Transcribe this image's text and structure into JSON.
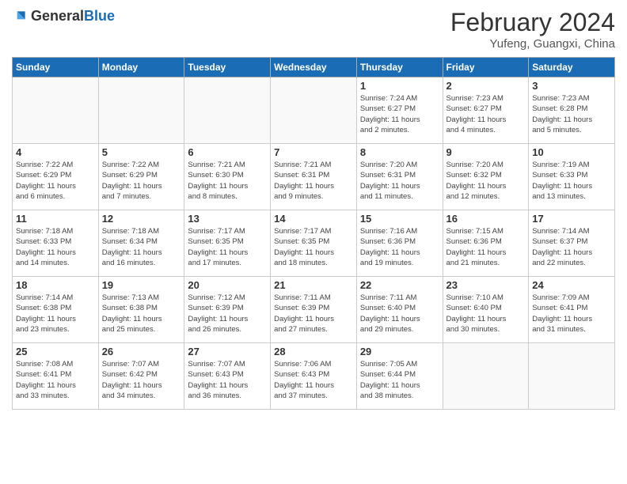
{
  "header": {
    "logo_general": "General",
    "logo_blue": "Blue",
    "month_year": "February 2024",
    "location": "Yufeng, Guangxi, China"
  },
  "weekdays": [
    "Sunday",
    "Monday",
    "Tuesday",
    "Wednesday",
    "Thursday",
    "Friday",
    "Saturday"
  ],
  "weeks": [
    [
      {
        "day": "",
        "info": ""
      },
      {
        "day": "",
        "info": ""
      },
      {
        "day": "",
        "info": ""
      },
      {
        "day": "",
        "info": ""
      },
      {
        "day": "1",
        "info": "Sunrise: 7:24 AM\nSunset: 6:27 PM\nDaylight: 11 hours\nand 2 minutes."
      },
      {
        "day": "2",
        "info": "Sunrise: 7:23 AM\nSunset: 6:27 PM\nDaylight: 11 hours\nand 4 minutes."
      },
      {
        "day": "3",
        "info": "Sunrise: 7:23 AM\nSunset: 6:28 PM\nDaylight: 11 hours\nand 5 minutes."
      }
    ],
    [
      {
        "day": "4",
        "info": "Sunrise: 7:22 AM\nSunset: 6:29 PM\nDaylight: 11 hours\nand 6 minutes."
      },
      {
        "day": "5",
        "info": "Sunrise: 7:22 AM\nSunset: 6:29 PM\nDaylight: 11 hours\nand 7 minutes."
      },
      {
        "day": "6",
        "info": "Sunrise: 7:21 AM\nSunset: 6:30 PM\nDaylight: 11 hours\nand 8 minutes."
      },
      {
        "day": "7",
        "info": "Sunrise: 7:21 AM\nSunset: 6:31 PM\nDaylight: 11 hours\nand 9 minutes."
      },
      {
        "day": "8",
        "info": "Sunrise: 7:20 AM\nSunset: 6:31 PM\nDaylight: 11 hours\nand 11 minutes."
      },
      {
        "day": "9",
        "info": "Sunrise: 7:20 AM\nSunset: 6:32 PM\nDaylight: 11 hours\nand 12 minutes."
      },
      {
        "day": "10",
        "info": "Sunrise: 7:19 AM\nSunset: 6:33 PM\nDaylight: 11 hours\nand 13 minutes."
      }
    ],
    [
      {
        "day": "11",
        "info": "Sunrise: 7:18 AM\nSunset: 6:33 PM\nDaylight: 11 hours\nand 14 minutes."
      },
      {
        "day": "12",
        "info": "Sunrise: 7:18 AM\nSunset: 6:34 PM\nDaylight: 11 hours\nand 16 minutes."
      },
      {
        "day": "13",
        "info": "Sunrise: 7:17 AM\nSunset: 6:35 PM\nDaylight: 11 hours\nand 17 minutes."
      },
      {
        "day": "14",
        "info": "Sunrise: 7:17 AM\nSunset: 6:35 PM\nDaylight: 11 hours\nand 18 minutes."
      },
      {
        "day": "15",
        "info": "Sunrise: 7:16 AM\nSunset: 6:36 PM\nDaylight: 11 hours\nand 19 minutes."
      },
      {
        "day": "16",
        "info": "Sunrise: 7:15 AM\nSunset: 6:36 PM\nDaylight: 11 hours\nand 21 minutes."
      },
      {
        "day": "17",
        "info": "Sunrise: 7:14 AM\nSunset: 6:37 PM\nDaylight: 11 hours\nand 22 minutes."
      }
    ],
    [
      {
        "day": "18",
        "info": "Sunrise: 7:14 AM\nSunset: 6:38 PM\nDaylight: 11 hours\nand 23 minutes."
      },
      {
        "day": "19",
        "info": "Sunrise: 7:13 AM\nSunset: 6:38 PM\nDaylight: 11 hours\nand 25 minutes."
      },
      {
        "day": "20",
        "info": "Sunrise: 7:12 AM\nSunset: 6:39 PM\nDaylight: 11 hours\nand 26 minutes."
      },
      {
        "day": "21",
        "info": "Sunrise: 7:11 AM\nSunset: 6:39 PM\nDaylight: 11 hours\nand 27 minutes."
      },
      {
        "day": "22",
        "info": "Sunrise: 7:11 AM\nSunset: 6:40 PM\nDaylight: 11 hours\nand 29 minutes."
      },
      {
        "day": "23",
        "info": "Sunrise: 7:10 AM\nSunset: 6:40 PM\nDaylight: 11 hours\nand 30 minutes."
      },
      {
        "day": "24",
        "info": "Sunrise: 7:09 AM\nSunset: 6:41 PM\nDaylight: 11 hours\nand 31 minutes."
      }
    ],
    [
      {
        "day": "25",
        "info": "Sunrise: 7:08 AM\nSunset: 6:41 PM\nDaylight: 11 hours\nand 33 minutes."
      },
      {
        "day": "26",
        "info": "Sunrise: 7:07 AM\nSunset: 6:42 PM\nDaylight: 11 hours\nand 34 minutes."
      },
      {
        "day": "27",
        "info": "Sunrise: 7:07 AM\nSunset: 6:43 PM\nDaylight: 11 hours\nand 36 minutes."
      },
      {
        "day": "28",
        "info": "Sunrise: 7:06 AM\nSunset: 6:43 PM\nDaylight: 11 hours\nand 37 minutes."
      },
      {
        "day": "29",
        "info": "Sunrise: 7:05 AM\nSunset: 6:44 PM\nDaylight: 11 hours\nand 38 minutes."
      },
      {
        "day": "",
        "info": ""
      },
      {
        "day": "",
        "info": ""
      }
    ]
  ]
}
